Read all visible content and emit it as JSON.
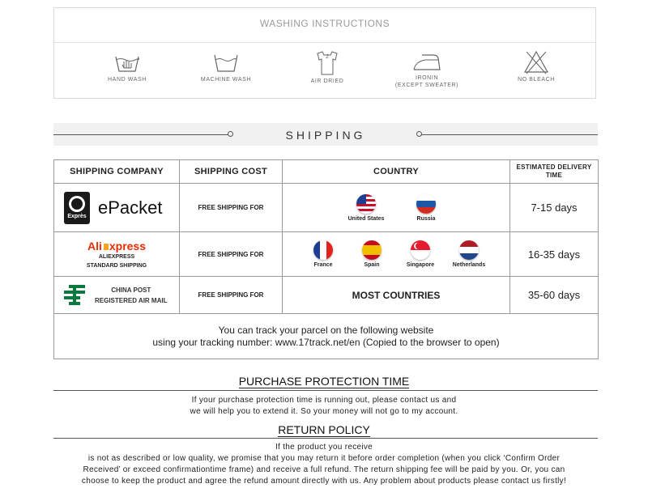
{
  "washing": {
    "title": "WASHING INSTRUCTIONS",
    "items": [
      {
        "label": "HAND WASH",
        "icon": "hand-wash-icon"
      },
      {
        "label": "MACHINE WASH",
        "icon": "machine-wash-icon"
      },
      {
        "label": "AIR DRIED",
        "icon": "air-dried-icon"
      },
      {
        "label": "IRONIN",
        "sub": "(EXCEPT SWEATER)",
        "icon": "iron-icon"
      },
      {
        "label": "NO BLEACH",
        "icon": "no-bleach-icon"
      }
    ]
  },
  "shipping": {
    "title": "SHIPPING",
    "headers": [
      "SHIPPING COMPANY",
      "SHIPPING COST",
      "COUNTRY",
      "ESTIMATED DELIVERY TIME"
    ],
    "rows": [
      {
        "carrier": "ePacket",
        "logo_text": "Exprès",
        "cost": "FREE SHIPPING FOR",
        "countries": [
          "United States",
          "Russia"
        ],
        "time": "7-15 days"
      },
      {
        "carrier_logo_a": "Ali",
        "carrier_logo_b": "xpress",
        "carrier_line1": "ALIEXPRESS",
        "carrier_line2": "STANDARD SHIPPING",
        "cost": "FREE SHIPPING FOR",
        "countries": [
          "France",
          "Spain",
          "Singapore",
          "Netherlands"
        ],
        "time": "16-35 days"
      },
      {
        "carrier_line1": "CHINA POST",
        "carrier_line2": "REGISTERED AIR MAIL",
        "cost": "FREE SHIPPING FOR",
        "countries_text": "MOST COUNTRIES",
        "time": "35-60 days"
      }
    ],
    "track_line1": "You can track your parcel on the following website",
    "track_line2": "using your tracking number: www.17track.net/en (Copied to the browser to open)"
  },
  "protection": {
    "title": "PURCHASE PROTECTION TIME",
    "line1": "If your purchase protection time is running out, please contact us and",
    "line2": "we will help you to extend it. So your money will not go to my account."
  },
  "returns": {
    "title": "RETURN POLICY",
    "line1": "If the product you receive",
    "line2": "is not as described or low quality, we promise that you may return it before order completion (when you click ‘Confirm Order",
    "line3": "Received’ or exceed confirmationtime frame) and receive a full refund. The return shipping fee will be paid by you. Or, you can",
    "line4": "choose to keep the product and agree the refund amount directly with us. Any problem about products please contact us firstly!"
  },
  "colors": {
    "ali_red": "#e62e04",
    "ali_orange": "#f7a21b",
    "china_post_green": "#0a7a3c",
    "epacket_black": "#1a1a1a"
  }
}
